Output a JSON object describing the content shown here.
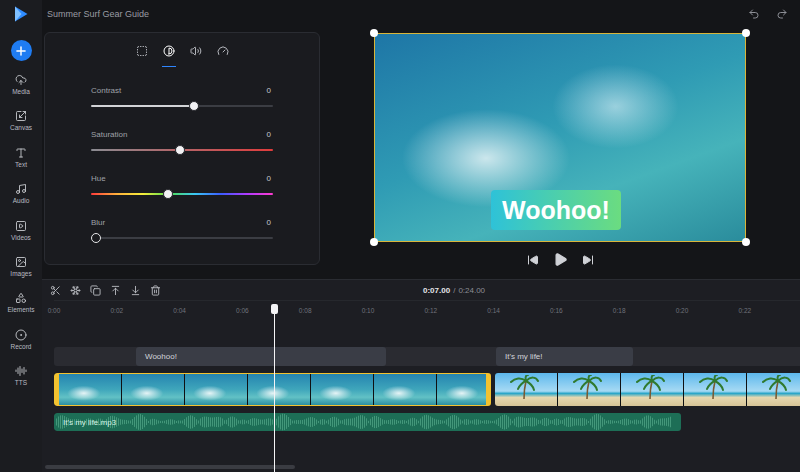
{
  "window": {
    "title": "Summer Surf Gear Guide"
  },
  "sidebar": {
    "items": [
      {
        "label": "Media"
      },
      {
        "label": "Canvas"
      },
      {
        "label": "Text"
      },
      {
        "label": "Audio"
      },
      {
        "label": "Videos"
      },
      {
        "label": "Images"
      },
      {
        "label": "Elements"
      },
      {
        "label": "Record"
      },
      {
        "label": "TTS"
      }
    ]
  },
  "adjust_panel": {
    "tabs": [
      {
        "selected": false
      },
      {
        "selected": true
      },
      {
        "selected": false
      },
      {
        "selected": false
      }
    ],
    "sliders": [
      {
        "label": "Contrast",
        "value": "0",
        "level": 0.57,
        "kind": "contrast"
      },
      {
        "label": "Saturation",
        "value": "0",
        "level": 0.49,
        "kind": "saturation"
      },
      {
        "label": "Hue",
        "value": "0",
        "level": 0.42,
        "kind": "hue"
      },
      {
        "label": "Blur",
        "value": "0",
        "level": 0,
        "kind": "blur"
      }
    ]
  },
  "preview": {
    "caption": "Woohoo!",
    "selected": true
  },
  "player": {
    "playing": false
  },
  "timeline": {
    "current_time": "0:07.00",
    "separator": "/",
    "total_time": "0:24.00",
    "ruler": [
      "0:00",
      "0:02",
      "0:04",
      "0:06",
      "0:08",
      "0:10",
      "0:12",
      "0:14",
      "0:16",
      "0:18",
      "0:20",
      "0:22"
    ],
    "text_clips": [
      {
        "label": "Woohoo!"
      },
      {
        "label": "It's my life!"
      }
    ],
    "video_clips": [
      {
        "selected": true,
        "kind": "surf"
      },
      {
        "selected": false,
        "kind": "beach"
      }
    ],
    "audio_clips": [
      {
        "label": "It's my life.mp3"
      }
    ]
  }
}
